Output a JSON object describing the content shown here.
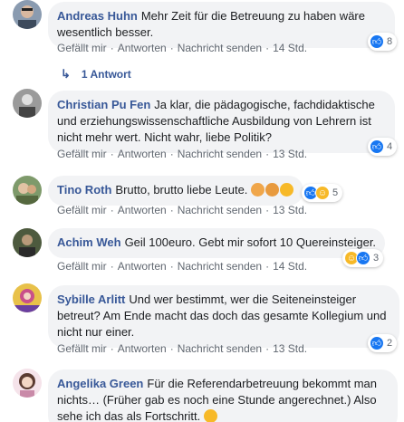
{
  "comments": [
    {
      "author": "Andreas Huhn",
      "text": "Mehr Zeit für die Betreuung zu haben wäre wesentlich besser.",
      "like": "Gefällt mir",
      "reply": "Antworten",
      "message": "Nachricht senden",
      "time": "14 Std.",
      "reaction_count": "8",
      "reactions": [
        "like-icon"
      ],
      "avatar_colors": [
        "#8a9bb0",
        "#d8b8a0"
      ]
    },
    {
      "author": "Christian Pu Fen",
      "text": "Ja klar, die pädagogische, fachdidaktische und erziehungswissenschaftliche Ausbildung von Lehrern ist nicht mehr wert. Nicht wahr, liebe Politik?",
      "like": "Gefällt mir",
      "reply": "Antworten",
      "message": "Nachricht senden",
      "time": "13 Std.",
      "reaction_count": "4",
      "reactions": [
        "like-icon"
      ],
      "avatar_colors": [
        "#6a6a6a",
        "#c9c9c9"
      ]
    },
    {
      "author": "Tino Roth",
      "text": "Brutto, brutto liebe Leute.",
      "like": "Gefällt mir",
      "reply": "Antworten",
      "message": "Nachricht senden",
      "time": "13 Std.",
      "reaction_count": "5",
      "reactions": [
        "like-icon",
        "haha-icon"
      ],
      "avatar_colors": [
        "#7e9a6b",
        "#e1c3a4"
      ]
    },
    {
      "author": "Achim Weh",
      "text": "Geil 100euro. Gebt mir sofort 10 Quereinsteiger.",
      "like": "Gefällt mir",
      "reply": "Antworten",
      "message": "Nachricht senden",
      "time": "14 Std.",
      "reaction_count": "3",
      "reactions": [
        "haha-icon",
        "like-icon"
      ],
      "avatar_colors": [
        "#4d5a3e",
        "#b89a7a"
      ]
    },
    {
      "author": "Sybille Arlitt",
      "text": "Und wer bestimmt, wer die Seiteneinsteiger betreut? Am Ende macht das doch das gesamte Kollegium und nicht nur einer.",
      "like": "Gefällt mir",
      "reply": "Antworten",
      "message": "Nachricht senden",
      "time": "13 Std.",
      "reaction_count": "2",
      "reactions": [
        "like-icon"
      ],
      "avatar_colors": [
        "#c94f8a",
        "#f0c040"
      ]
    },
    {
      "author": "Angelika Green",
      "text": "Für die Referendarbetreuung bekommt man nichts… (Früher gab es noch eine Stunde angerechnet.) Also sehe ich das als Fortschritt.",
      "avatar_colors": [
        "#c98aa8",
        "#f3d6c4"
      ]
    }
  ],
  "reply_thread": {
    "label": "1 Antwort"
  },
  "colors": {
    "author": "#385898",
    "bubble": "#f2f3f5",
    "meta": "#606770",
    "like": "#1877f2",
    "haha": "#f7b928"
  }
}
